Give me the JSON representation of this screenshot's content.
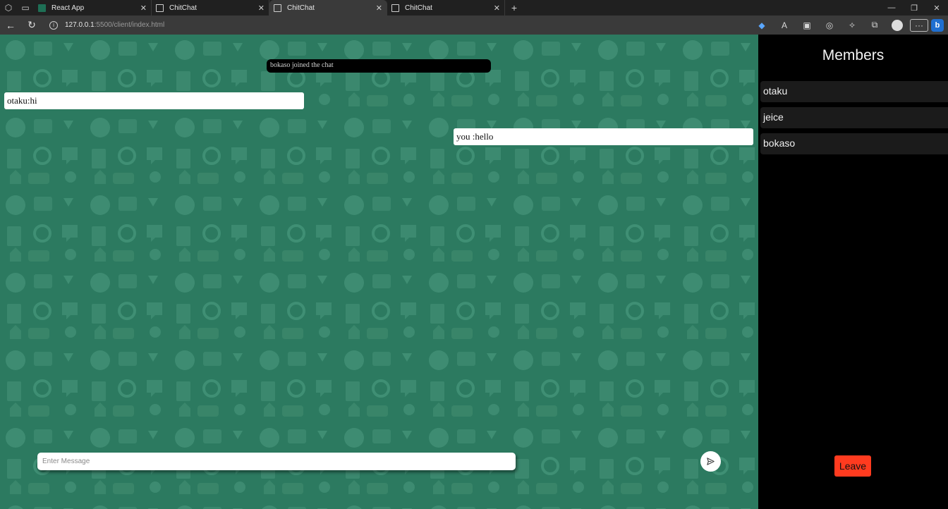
{
  "browser": {
    "tabs": [
      {
        "title": "React App",
        "icon": "react-app-icon",
        "active": false
      },
      {
        "title": "ChitChat",
        "icon": "page-icon",
        "active": false
      },
      {
        "title": "ChitChat",
        "icon": "page-icon",
        "active": true
      },
      {
        "title": "ChitChat",
        "icon": "page-icon",
        "active": false
      }
    ],
    "url_host": "127.0.0.1",
    "url_rest": ":5500/client/index.html"
  },
  "chat": {
    "notice": "bokaso joined the chat",
    "messages": [
      {
        "side": "left",
        "text": "otaku:hi"
      },
      {
        "side": "right",
        "text": "you :hello"
      }
    ],
    "input_placeholder": "Enter Message",
    "send_icon": "send-icon",
    "background_color": "#2c7a60"
  },
  "members": {
    "title": "Members",
    "list": [
      "otaku",
      "jeice",
      "bokaso"
    ],
    "leave_label": "Leave",
    "leave_color": "#ff3b1f"
  }
}
